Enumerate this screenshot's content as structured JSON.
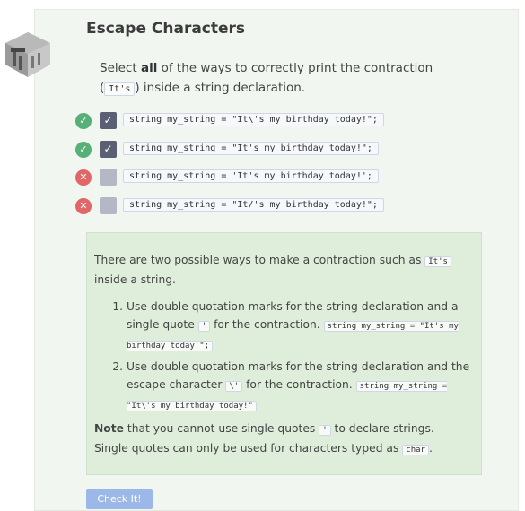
{
  "title": "Escape Characters",
  "question": {
    "prefix": "Select ",
    "bold": "all",
    "middle": " of the ways to correctly print the contraction (",
    "code": "It's",
    "suffix": ") inside a string declaration."
  },
  "options": [
    {
      "status": "correct",
      "status_glyph": "✓",
      "checked": true,
      "checkmark": "✓",
      "code": "string my_string = \"It\\'s my birthday today!\";"
    },
    {
      "status": "correct",
      "status_glyph": "✓",
      "checked": true,
      "checkmark": "✓",
      "code": "string my_string = \"It's my birthday today!\";"
    },
    {
      "status": "incorrect",
      "status_glyph": "✕",
      "checked": false,
      "checkmark": "",
      "code": "string my_string = 'It's my birthday today!';"
    },
    {
      "status": "incorrect",
      "status_glyph": "✕",
      "checked": false,
      "checkmark": "",
      "code": "string my_string = \"It/'s my birthday today!\";"
    }
  ],
  "explanation": {
    "intro_before": "There are two possible ways to make a contraction such as ",
    "intro_code": "It's",
    "intro_after": " inside a string.",
    "items": [
      {
        "text_before": "Use double quotation marks for the string declaration and a single quote ",
        "code1": "'",
        "text_mid": " for the contraction. ",
        "code2": "string my_string = \"It's my birthday today!\";"
      },
      {
        "text_before": "Use double quotation marks for the string declaration and the escape character ",
        "code1": "\\'",
        "text_mid": " for the contraction. ",
        "code2": "string my_string = \"It\\'s my birthday today!\""
      }
    ],
    "note_bold": "Note",
    "note_before": " that you cannot use single quotes ",
    "note_code1": "'",
    "note_mid": " to declare strings. Single quotes can only be used for characters typed as ",
    "note_code2": "char",
    "note_after": "."
  },
  "check_button": "Check It!",
  "icons": {
    "logo": "building-logo-icon",
    "correct": "check-circle-icon",
    "incorrect": "x-circle-icon"
  },
  "colors": {
    "correct": "#58b078",
    "incorrect": "#e06767",
    "button": "#9cb8e8",
    "explain_bg": "#dfeedb"
  }
}
